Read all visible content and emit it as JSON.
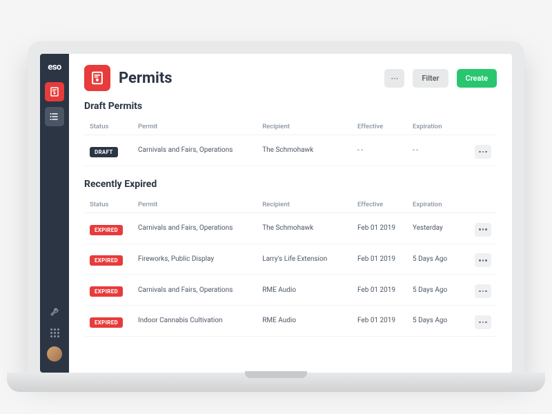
{
  "app": {
    "logo": "eso"
  },
  "header": {
    "title": "Permits",
    "more_label": "⋯",
    "filter_label": "Filter",
    "create_label": "Create"
  },
  "columns": {
    "status": "Status",
    "permit": "Permit",
    "recipient": "Recipient",
    "effective": "Effective",
    "expiration": "Expiration"
  },
  "draft_section": {
    "title": "Draft Permits",
    "rows": [
      {
        "status": "DRAFT",
        "permit": "Carnivals and Fairs, Operations",
        "recipient": "The Schmohawk",
        "effective": "- -",
        "expiration": "- -"
      }
    ]
  },
  "expired_section": {
    "title": "Recently Expired",
    "rows": [
      {
        "status": "EXPIRED",
        "permit": "Carnivals and Fairs, Operations",
        "recipient": "The Schmohawk",
        "effective": "Feb 01 2019",
        "expiration": "Yesterday"
      },
      {
        "status": "EXPIRED",
        "permit": "Fireworks, Public Display",
        "recipient": "Larry's Life Extension",
        "effective": "Feb 01 2019",
        "expiration": "5 Days Ago"
      },
      {
        "status": "EXPIRED",
        "permit": "Carnivals and Fairs, Operations",
        "recipient": "RME Audio",
        "effective": "Feb 01 2019",
        "expiration": "5 Days Ago"
      },
      {
        "status": "EXPIRED",
        "permit": "Indoor Cannabis Cultivation",
        "recipient": "RME Audio",
        "effective": "Feb 01 2019",
        "expiration": "5 Days Ago"
      }
    ]
  },
  "colors": {
    "accent": "#e83b3b",
    "success": "#28c76f",
    "dark": "#2b3544"
  }
}
